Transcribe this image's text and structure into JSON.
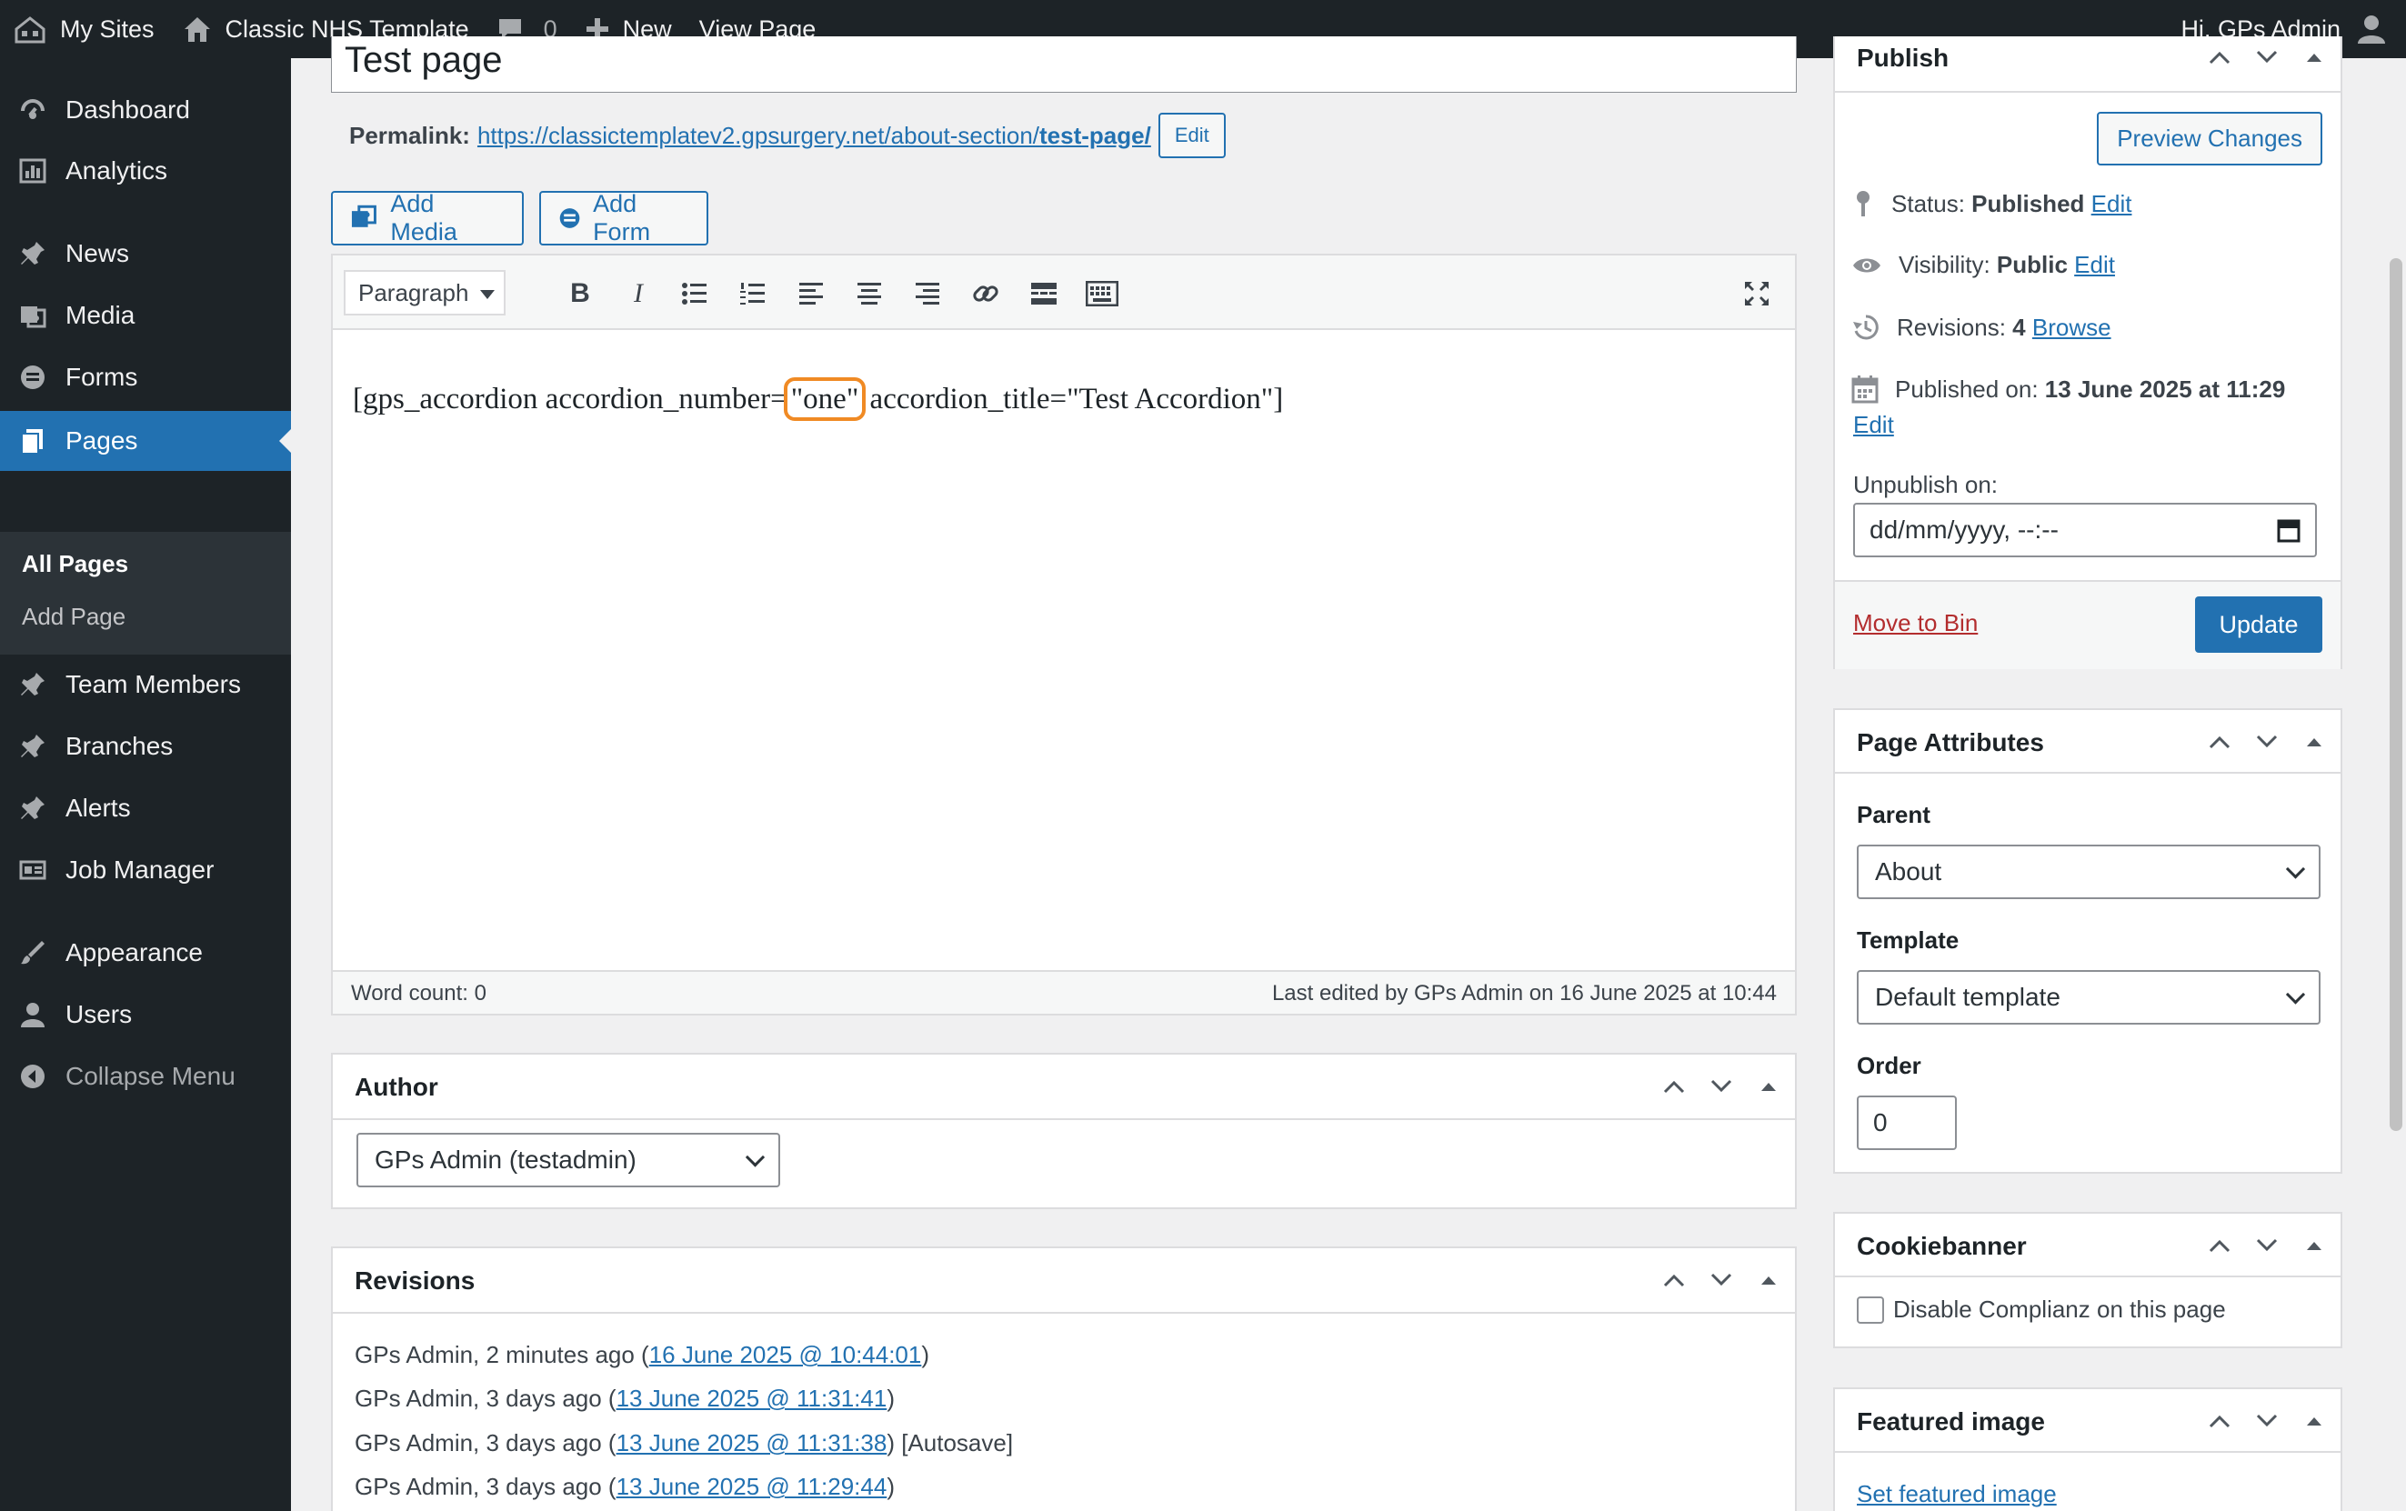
{
  "adminbar": {
    "my_sites": "My Sites",
    "site_name": "Classic NHS Template",
    "comments_count": "0",
    "new_label": "New",
    "view_page": "View Page",
    "greeting": "Hi, GPs Admin"
  },
  "sidebar": {
    "items": [
      {
        "label": "Dashboard",
        "icon": "dashboard-icon"
      },
      {
        "label": "Analytics",
        "icon": "analytics-icon"
      },
      {
        "label": "News",
        "icon": "pin-icon"
      },
      {
        "label": "Media",
        "icon": "media-icon"
      },
      {
        "label": "Forms",
        "icon": "forms-icon"
      },
      {
        "label": "Pages",
        "icon": "pages-icon"
      },
      {
        "label": "Team Members",
        "icon": "pin-icon"
      },
      {
        "label": "Branches",
        "icon": "pin-icon"
      },
      {
        "label": "Alerts",
        "icon": "pin-icon"
      },
      {
        "label": "Job Manager",
        "icon": "job-manager-icon"
      },
      {
        "label": "Appearance",
        "icon": "appearance-icon"
      },
      {
        "label": "Users",
        "icon": "users-icon"
      },
      {
        "label": "Collapse Menu",
        "icon": "collapse-icon"
      }
    ],
    "submenu": [
      "All Pages",
      "Add Page"
    ]
  },
  "editor": {
    "title": "Test page",
    "permalink_label": "Permalink:",
    "permalink_base": "https://classictemplatev2.gpsurgery.net/about-section/",
    "permalink_slug": "test-page/",
    "permalink_edit": "Edit",
    "add_media": "Add Media",
    "add_form": "Add Form",
    "format": "Paragraph",
    "content_before": "[gps_accordion accordion_number=",
    "content_highlight": "\"one\"",
    "content_after": " accordion_title=\"Test Accordion\"]",
    "word_count": "Word count: 0",
    "last_edited": "Last edited by GPs Admin on 16 June 2025 at 10:44"
  },
  "author": {
    "title": "Author",
    "selected": "GPs Admin (testadmin)"
  },
  "revisions": {
    "title": "Revisions",
    "items": [
      {
        "prefix": "GPs Admin, 2 minutes ago (",
        "link": "16 June 2025 @ 10:44:01",
        "suffix": ")"
      },
      {
        "prefix": "GPs Admin, 3 days ago (",
        "link": "13 June 2025 @ 11:31:41",
        "suffix": ")"
      },
      {
        "prefix": "GPs Admin, 3 days ago (",
        "link": "13 June 2025 @ 11:31:38",
        "suffix": ") [Autosave]"
      },
      {
        "prefix": "GPs Admin, 3 days ago (",
        "link": "13 June 2025 @ 11:29:44",
        "suffix": ")"
      }
    ]
  },
  "publish": {
    "title": "Publish",
    "preview": "Preview Changes",
    "status_label": "Status:",
    "status_value": "Published",
    "visibility_label": "Visibility:",
    "visibility_value": "Public",
    "revisions_label": "Revisions:",
    "revisions_value": "4",
    "browse": "Browse",
    "published_label": "Published on:",
    "published_value": "13 June 2025 at 11:29",
    "edit": "Edit",
    "unpublish_label": "Unpublish on:",
    "unpublish_placeholder": "dd/mm/yyyy, --:--",
    "move_to_bin": "Move to Bin",
    "update": "Update"
  },
  "page_attributes": {
    "title": "Page Attributes",
    "parent_label": "Parent",
    "parent_value": "About",
    "template_label": "Template",
    "template_value": "Default template",
    "order_label": "Order",
    "order_value": "0"
  },
  "cookiebanner": {
    "title": "Cookiebanner",
    "checkbox_label": "Disable Complianz on this page"
  },
  "featured_image": {
    "title": "Featured image",
    "link": "Set featured image"
  },
  "colors": {
    "admin_dark": "#1d2327",
    "accent": "#2271b1",
    "danger": "#b32d2e",
    "highlight": "#f08a24"
  }
}
